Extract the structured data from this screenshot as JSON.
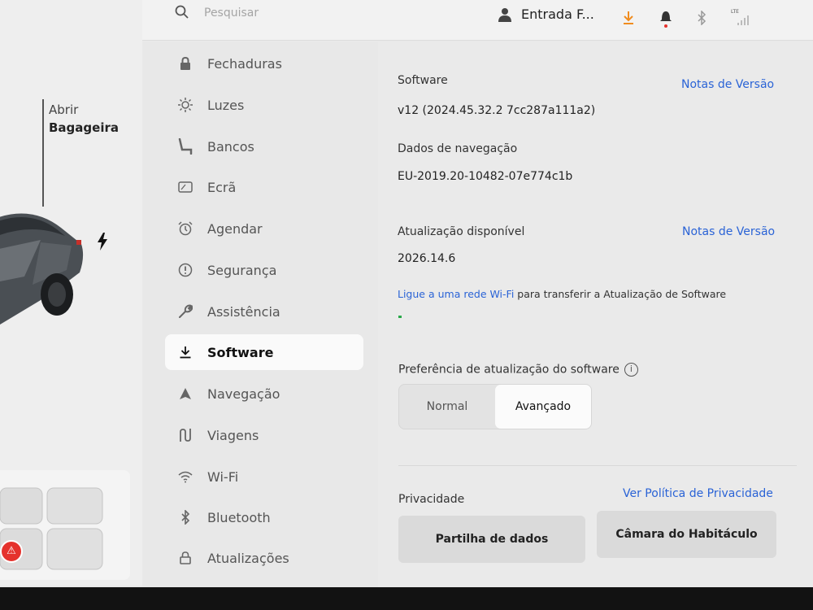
{
  "trunk": {
    "line1": "Abrir",
    "line2": "Bagageira"
  },
  "search": {
    "placeholder": "Pesquisar"
  },
  "profile": {
    "name": "Entrada F..."
  },
  "status": {
    "network": "LTE"
  },
  "menu": [
    {
      "label": "Fechaduras",
      "icon": "lock-icon"
    },
    {
      "label": "Luzes",
      "icon": "light-icon"
    },
    {
      "label": "Bancos",
      "icon": "seat-icon"
    },
    {
      "label": "Ecrã",
      "icon": "display-icon"
    },
    {
      "label": "Agendar",
      "icon": "alarm-clock-icon"
    },
    {
      "label": "Segurança",
      "icon": "alert-circle-icon"
    },
    {
      "label": "Assistência",
      "icon": "wrench-icon"
    },
    {
      "label": "Software",
      "icon": "download-icon",
      "active": true
    },
    {
      "label": "Navegação",
      "icon": "navigation-arrow-icon"
    },
    {
      "label": "Viagens",
      "icon": "trips-icon"
    },
    {
      "label": "Wi-Fi",
      "icon": "wifi-icon"
    },
    {
      "label": "Bluetooth",
      "icon": "bluetooth-icon"
    },
    {
      "label": "Atualizações",
      "icon": "lock-open-icon"
    }
  ],
  "software": {
    "title": "Software",
    "release_notes": "Notas de Versão",
    "version": "v12 (2024.45.32.2 7cc287a111a2)",
    "nav_title": "Dados de navegação",
    "nav_value": "EU-2019.20-10482-07e774c1b",
    "update_title": "Atualização disponível",
    "update_notes": "Notas de Versão",
    "update_version": "2026.14.6",
    "wifi_link": "Ligue a uma rede Wi-Fi",
    "wifi_rest": " para transferir a Atualização de Software"
  },
  "preference": {
    "title": "Preferência de atualização do software",
    "info": "i",
    "options": [
      "Normal",
      "Avançado"
    ],
    "selected": "Avançado"
  },
  "privacy": {
    "title": "Privacidade",
    "policy_link": "Ver Política de Privacidade",
    "data_sharing": "Partilha de dados",
    "cabin_camera": "Câmara do Habitáculo"
  },
  "colors": {
    "accent": "#2a63d6",
    "alert": "#e5322d",
    "download": "#f08c1e"
  }
}
